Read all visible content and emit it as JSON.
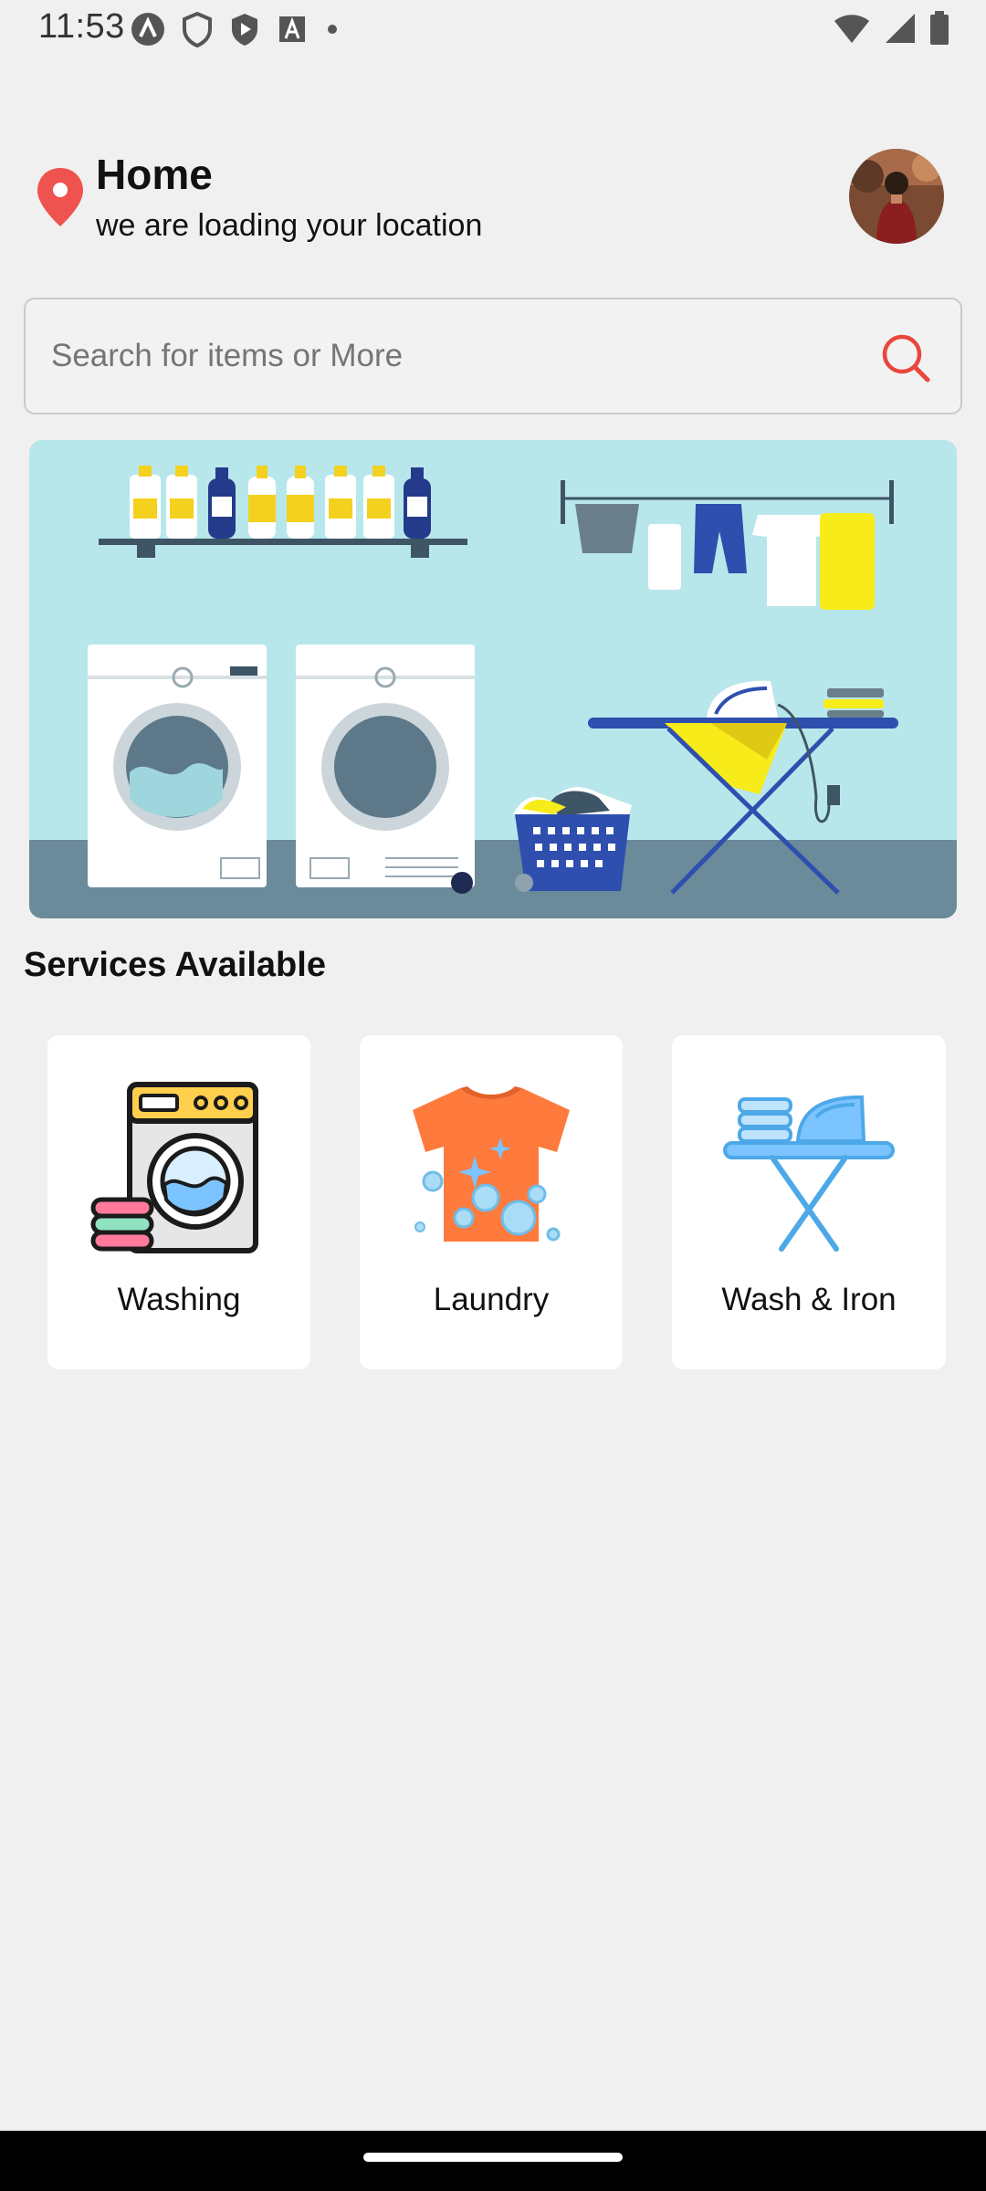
{
  "status_bar": {
    "time": "11:53",
    "left_icons": [
      "app-icon-a",
      "shield-outline-icon",
      "shield-play-icon",
      "font-a-icon",
      "dot-icon"
    ],
    "right_icons": [
      "wifi-icon",
      "signal-icon",
      "battery-icon"
    ]
  },
  "header": {
    "location_title": "Home",
    "location_subtitle": "we are loading your location",
    "pin_color": "#ef5350"
  },
  "search": {
    "placeholder": "Search for items or More",
    "value": "",
    "icon_color": "#e8473c"
  },
  "banner": {
    "active_slide": 1,
    "slide_count": 2
  },
  "services": {
    "title": "Services Available",
    "items": [
      {
        "label": "Washing",
        "icon": "washing-machine-icon"
      },
      {
        "label": "Laundry",
        "icon": "tshirt-bubbles-icon"
      },
      {
        "label": "Wash & Iron",
        "icon": "ironing-board-icon"
      }
    ]
  }
}
